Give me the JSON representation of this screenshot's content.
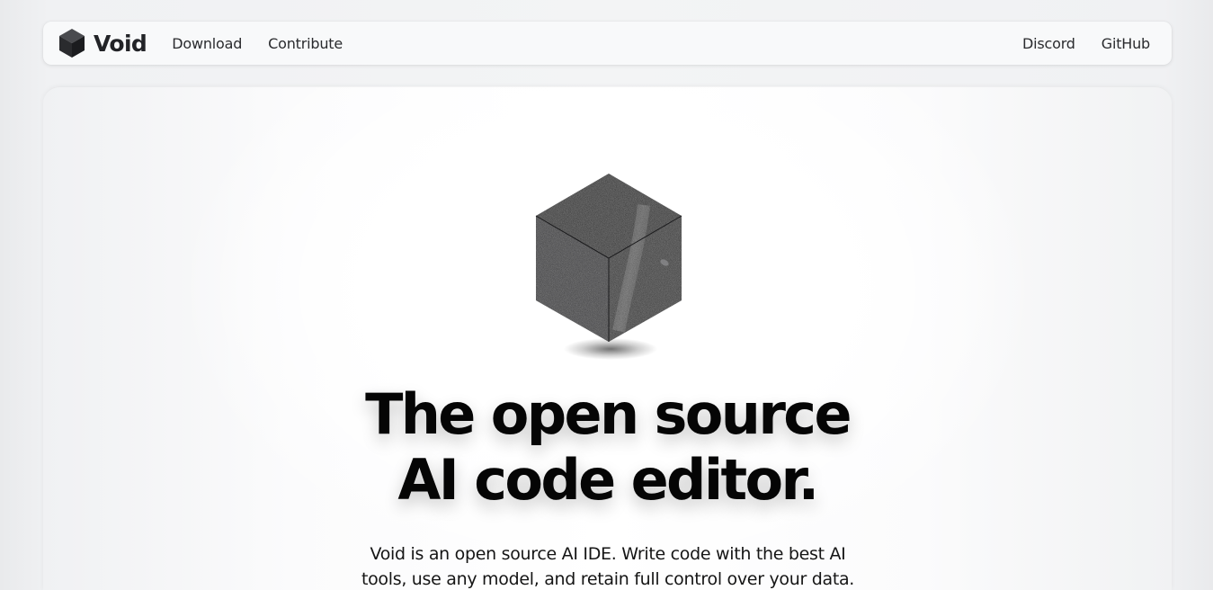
{
  "nav": {
    "brand": "Void",
    "links": {
      "download": "Download",
      "contribute": "Contribute",
      "discord": "Discord",
      "github": "GitHub"
    }
  },
  "hero": {
    "headline_line1": "The open source",
    "headline_line2": "AI code editor.",
    "description": "Void is an open source AI IDE. Write code with the best AI tools, use any model, and retain full control over your data."
  },
  "icons": {
    "logo": "void-cube-logo-icon",
    "hero": "black-cube-icon"
  },
  "colors": {
    "page_bg": "#f3f4f5",
    "nav_bg": "#f8f9fa",
    "card_bg": "#ffffff",
    "text": "#050505"
  }
}
